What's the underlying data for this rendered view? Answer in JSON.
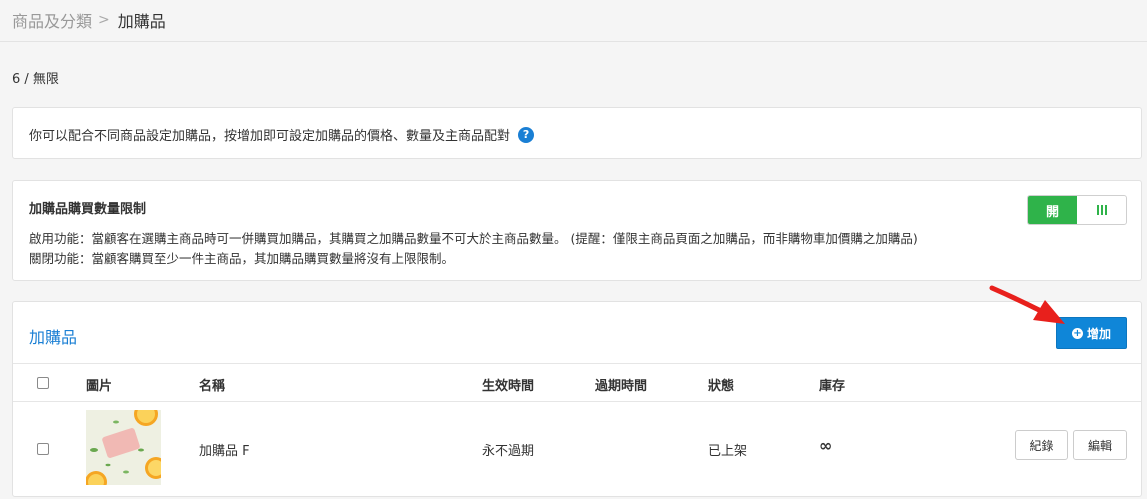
{
  "breadcrumb": {
    "parent": "商品及分類",
    "separator": ">",
    "current": "加購品"
  },
  "quota": "6 / 無限",
  "info": {
    "text": "你可以配合不同商品設定加購品，按增加即可設定加購品的價格、數量及主商品配對",
    "help_icon": "?"
  },
  "limit": {
    "title": "加購品購買數量限制",
    "desc_on": "啟用功能：當顧客在選購主商品時可一併購買加購品，其購買之加購品數量不可大於主商品數量。 (提醒：僅限主商品頁面之加購品，而非購物車加價購之加購品)",
    "desc_off": "關閉功能：當顧客購買至少一件主商品，其加購品購買數量將沒有上限限制。",
    "toggle_on_label": "開",
    "toggle_state": "on"
  },
  "list": {
    "title": "加購品",
    "add_button": "增加",
    "columns": [
      "圖片",
      "名稱",
      "生效時間",
      "過期時間",
      "狀態",
      "庫存"
    ],
    "rows": [
      {
        "name": "加購品 F",
        "start": "永不過期",
        "end": "",
        "status": "已上架",
        "stock": "∞",
        "log_button": "紀錄",
        "edit_button": "編輯"
      }
    ]
  },
  "colors": {
    "accent": "#0f86d8",
    "toggle_on": "#2fb34a",
    "arrow": "#e8201c"
  }
}
